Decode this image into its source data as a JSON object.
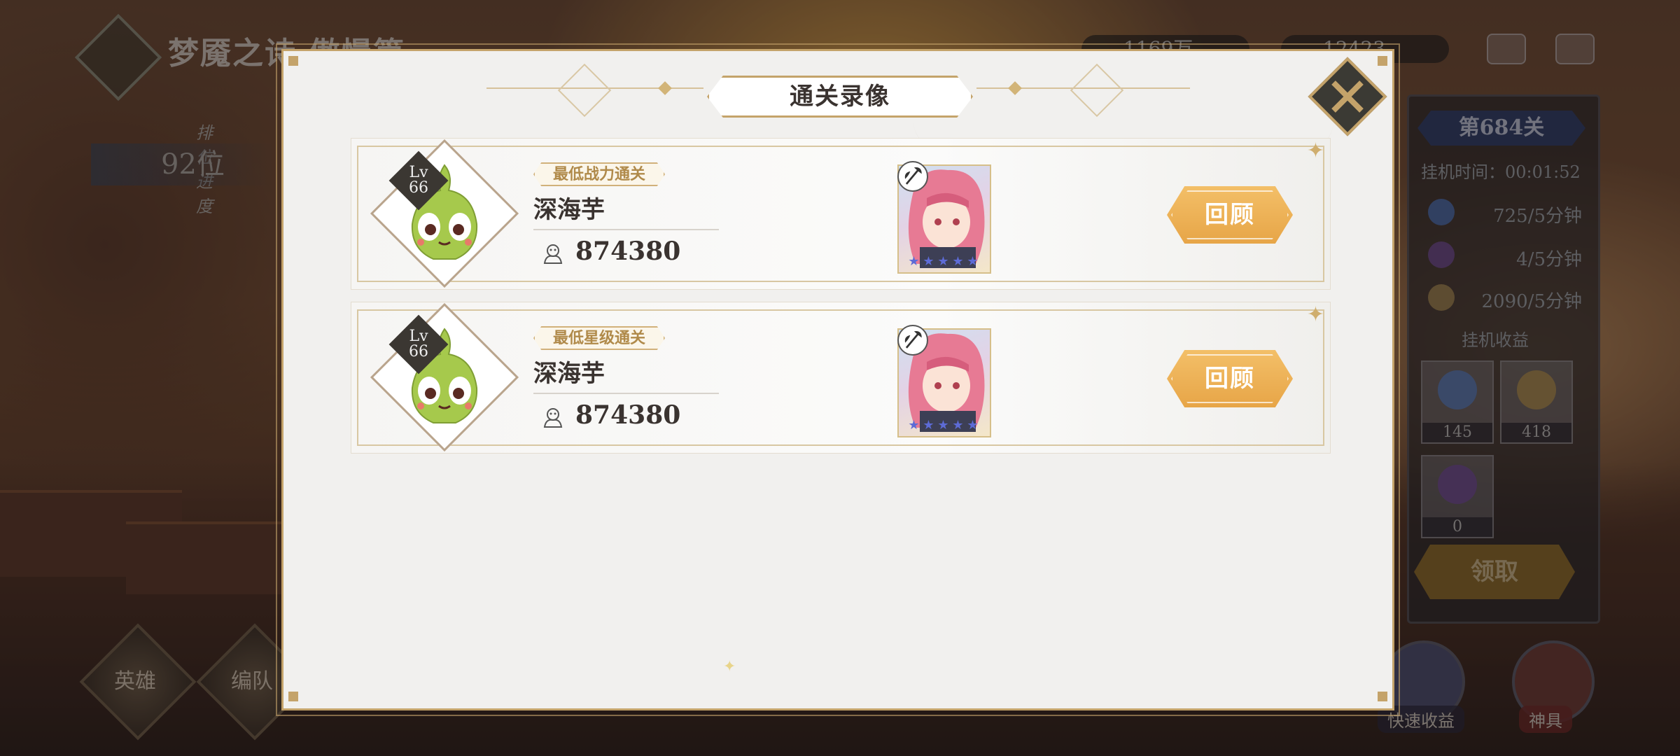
{
  "background": {
    "stage_title": "梦魇之诗 傲慢篇",
    "rank": {
      "label": "排位进度",
      "value": "92位"
    },
    "resources": [
      "1169万",
      "12423"
    ],
    "bottom_buttons": [
      {
        "label": "英雄"
      },
      {
        "label": "编队"
      }
    ],
    "side_panel": {
      "stage": "第684关",
      "idle_time": "挂机时间：00:01:52",
      "rates": [
        "725/5分钟",
        "4/5分钟",
        "2090/5分钟"
      ],
      "section_title": "挂机收益",
      "loot": [
        "145",
        "418",
        "0"
      ],
      "claim_label": "领取",
      "quick_label": "快速收益",
      "artifact_label": "神具"
    }
  },
  "modal": {
    "title": "通关录像",
    "records": [
      {
        "tag": "最低战力通关",
        "player_name": "深海芋",
        "level_prefix": "Lv",
        "level": "66",
        "power": "874380",
        "review_label": "回顾"
      },
      {
        "tag": "最低星级通关",
        "player_name": "深海芋",
        "level_prefix": "Lv",
        "level": "66",
        "power": "874380",
        "review_label": "回顾"
      }
    ]
  },
  "colors": {
    "accent_gold": "#c4a36a",
    "button_orange": "#eaa94b",
    "modal_bg": "#f1f0ee",
    "avatar_green": "#a6c94c"
  },
  "icons": {
    "close": "close-icon",
    "power": "power-icon",
    "class": "axe-class-icon"
  }
}
